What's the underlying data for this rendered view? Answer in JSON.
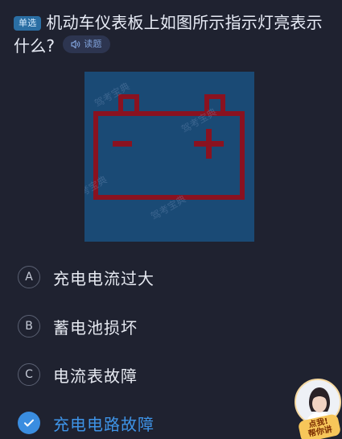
{
  "question": {
    "type_tag": "单选",
    "text": "机动车仪表板上如图所示指示灯亮表示什么?",
    "read_label": "读题"
  },
  "figure": {
    "watermark": "驾考宝典",
    "background": "#1a4a75",
    "symbol_color": "#8a1220",
    "icon": "battery-warning-icon"
  },
  "options": [
    {
      "letter": "A",
      "text": "充电电流过大",
      "selected": false
    },
    {
      "letter": "B",
      "text": "蓄电池损坏",
      "selected": false
    },
    {
      "letter": "C",
      "text": "电流表故障",
      "selected": false
    },
    {
      "letter": "D",
      "text": "充电电路故障",
      "selected": true
    }
  ],
  "assistant": {
    "line1": "点我!",
    "line2": "帮你讲"
  },
  "colors": {
    "background": "#1f2230",
    "accent": "#3a8de0"
  }
}
